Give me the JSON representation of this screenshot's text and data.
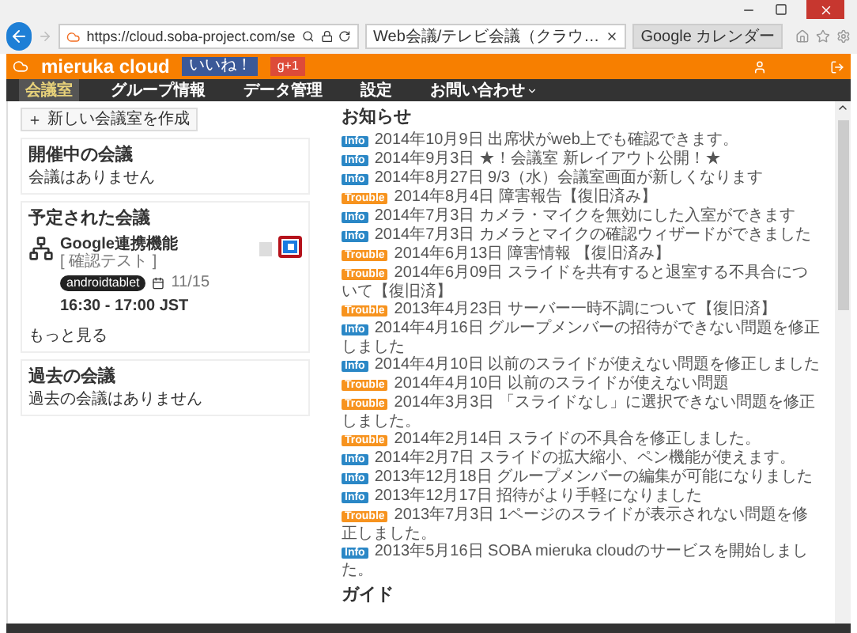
{
  "browser": {
    "address": "https://cloud.soba-project.com/se",
    "tabs": [
      {
        "label": "Web会議/テレビ会議（クラウ…",
        "selected": true
      },
      {
        "label": "Google カレンダー",
        "selected": false
      }
    ]
  },
  "header": {
    "logo": "mieruka cloud",
    "like_button": "いいね！",
    "plus_button": "g+1"
  },
  "nav": [
    {
      "label": "会議室",
      "selected": true,
      "dropdown": false
    },
    {
      "label": "グループ情報",
      "selected": false,
      "dropdown": false
    },
    {
      "label": "データ管理",
      "selected": false,
      "dropdown": false
    },
    {
      "label": "設定",
      "selected": false,
      "dropdown": false
    },
    {
      "label": "お問い合わせ",
      "selected": false,
      "dropdown": true
    }
  ],
  "new_room_button": "新しい会議室を作成",
  "sections": [
    {
      "title": "開催中の会議",
      "empty": "会議はありません"
    },
    {
      "title": "予定された会議",
      "meetings": [
        {
          "title": "Google連携機能",
          "subtitle": "[ 確認テスト ]",
          "tag": "androidtablet",
          "date": "11/15",
          "time": "16:30 - 17:00 JST",
          "highlighted": true
        }
      ],
      "more": "もっと見る"
    },
    {
      "title": "過去の会議",
      "empty": "過去の会議はありません"
    }
  ],
  "news": {
    "title": "お知らせ",
    "items": [
      {
        "kind": "info",
        "badge": "Info",
        "date": "2014年10月9日",
        "text": "出席状がweb上でも確認できます。"
      },
      {
        "kind": "info",
        "badge": "Info",
        "date": "2014年9月3日",
        "text": "★！会議室 新レイアウト公開！★"
      },
      {
        "kind": "info",
        "badge": "Info",
        "date": "2014年8月27日",
        "text": "9/3（水）会議室画面が新しくなります"
      },
      {
        "kind": "trouble",
        "badge": "Trouble",
        "date": "2014年8月4日",
        "text": "障害報告【復旧済み】"
      },
      {
        "kind": "info",
        "badge": "Info",
        "date": "2014年7月3日",
        "text": "カメラ・マイクを無効にした入室ができます"
      },
      {
        "kind": "info",
        "badge": "Info",
        "date": "2014年7月3日",
        "text": "カメラとマイクの確認ウィザードができました"
      },
      {
        "kind": "trouble",
        "badge": "Trouble",
        "date": "2014年6月13日",
        "text": "障害情報 【復旧済み】"
      },
      {
        "kind": "trouble",
        "badge": "Trouble",
        "date": "2014年6月09日",
        "text": "スライドを共有すると退室する不具合について【復旧済】"
      },
      {
        "kind": "trouble",
        "badge": "Trouble",
        "date": "2013年4月23日",
        "text": "サーバー一時不調について【復旧済】"
      },
      {
        "kind": "info",
        "badge": "Info",
        "date": "2014年4月16日",
        "text": "グループメンバーの招待ができない問題を修正しました"
      },
      {
        "kind": "info",
        "badge": "Info",
        "date": "2014年4月10日",
        "text": "以前のスライドが使えない問題を修正しました"
      },
      {
        "kind": "trouble",
        "badge": "Trouble",
        "date": "2014年4月10日",
        "text": "以前のスライドが使えない問題"
      },
      {
        "kind": "trouble",
        "badge": "Trouble",
        "date": "2014年3月3日",
        "text": "「スライドなし」に選択できない問題を修正しました。"
      },
      {
        "kind": "trouble",
        "badge": "Trouble",
        "date": "2014年2月14日",
        "text": "スライドの不具合を修正しました。"
      },
      {
        "kind": "info",
        "badge": "Info",
        "date": "2014年2月7日",
        "text": "スライドの拡大縮小、ペン機能が使えます。"
      },
      {
        "kind": "info",
        "badge": "Info",
        "date": "2013年12月18日",
        "text": "グループメンバーの編集が可能になりました"
      },
      {
        "kind": "info",
        "badge": "Info",
        "date": "2013年12月17日",
        "text": "招待がより手軽になりました"
      },
      {
        "kind": "trouble",
        "badge": "Trouble",
        "date": "2013年7月3日",
        "text": "1ページのスライドが表示されない問題を修正しました。"
      },
      {
        "kind": "info",
        "badge": "Info",
        "date": "2013年5月16日",
        "text": "SOBA mieruka cloudのサービスを開始しました。"
      }
    ]
  },
  "guide": {
    "title": "ガイド"
  }
}
